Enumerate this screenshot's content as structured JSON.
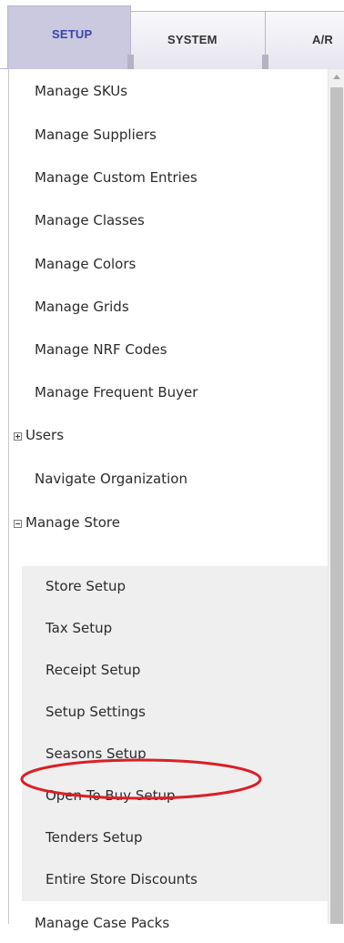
{
  "tabs": {
    "setup": "SETUP",
    "system": "SYSTEM",
    "ar": "A/R"
  },
  "menu": {
    "manage_skus": "Manage SKUs",
    "manage_suppliers": "Manage Suppliers",
    "manage_custom_entries": "Manage Custom Entries",
    "manage_classes": "Manage Classes",
    "manage_colors": "Manage Colors",
    "manage_grids": "Manage Grids",
    "manage_nrf_codes": "Manage NRF Codes",
    "manage_frequent_buyer": "Manage Frequent Buyer",
    "users": "Users",
    "navigate_organization": "Navigate Organization",
    "manage_store": "Manage Store",
    "manage_case_packs": "Manage Case Packs"
  },
  "manage_store_submenu": {
    "store_setup": "Store Setup",
    "tax_setup": "Tax Setup",
    "receipt_setup": "Receipt Setup",
    "setup_settings": "Setup Settings",
    "seasons_setup": "Seasons Setup",
    "open_to_buy_setup": "Open To Buy Setup",
    "tenders_setup": "Tenders Setup",
    "entire_store_discounts": "Entire Store Discounts"
  },
  "tree_state": {
    "users": "collapsed",
    "manage_store": "expanded"
  },
  "colors": {
    "active_tab_bg": "#cac9e0",
    "active_tab_text": "#3d44a8",
    "submenu_bg": "#efefef",
    "highlight_circle": "#d91f26"
  },
  "icons": {
    "users_toggle": "plus-box-icon",
    "manage_store_toggle": "minus-box-icon",
    "scroll_up": "caret-up-icon"
  }
}
